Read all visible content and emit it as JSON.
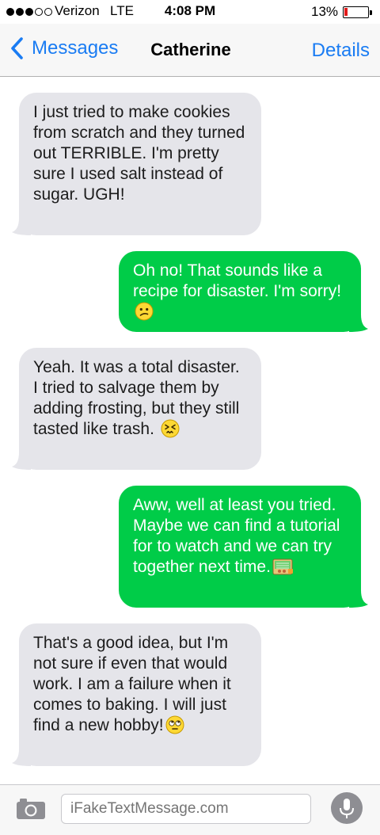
{
  "status_bar": {
    "carrier": "Verizon",
    "network": "LTE",
    "time": "4:08 PM",
    "battery_percent": "13%",
    "battery_level": 0.13,
    "signal_bars_filled": 3,
    "signal_bars_total": 5
  },
  "nav": {
    "back_label": "Messages",
    "contact_name": "Catherine",
    "details_label": "Details"
  },
  "messages": [
    {
      "direction": "received",
      "text": "I just tried to make cookies from scratch and they turned out TERRIBLE. I'm pretty sure I used salt instead of sugar. UGH!"
    },
    {
      "direction": "sent",
      "text": "Oh no! That sounds like a recipe for disaster. I'm sorry!",
      "emoji": "confused-face-emoji"
    },
    {
      "direction": "received",
      "text": "Yeah. It was a total disaster. I tried to salvage them by adding frosting, but they still tasted like trash.",
      "emoji": "persevering-face-emoji"
    },
    {
      "direction": "sent",
      "text": "Aww, well at least you tried. Maybe we can find a tutorial for to watch and we can try together next time.",
      "emoji": "cookbook-emoji"
    },
    {
      "direction": "received",
      "text": "That's a good idea, but I'm not sure if even that would work. I am a failure when it comes to baking. I will just find a new hobby!",
      "emoji": "rolling-eyes-emoji"
    }
  ],
  "input": {
    "placeholder": "iFakeTextMessage.com"
  },
  "colors": {
    "accent_blue": "#1a7cf3",
    "sent_bubble": "#00cc48",
    "received_bubble": "#e5e5ea",
    "battery_low": "#e21b1b"
  }
}
